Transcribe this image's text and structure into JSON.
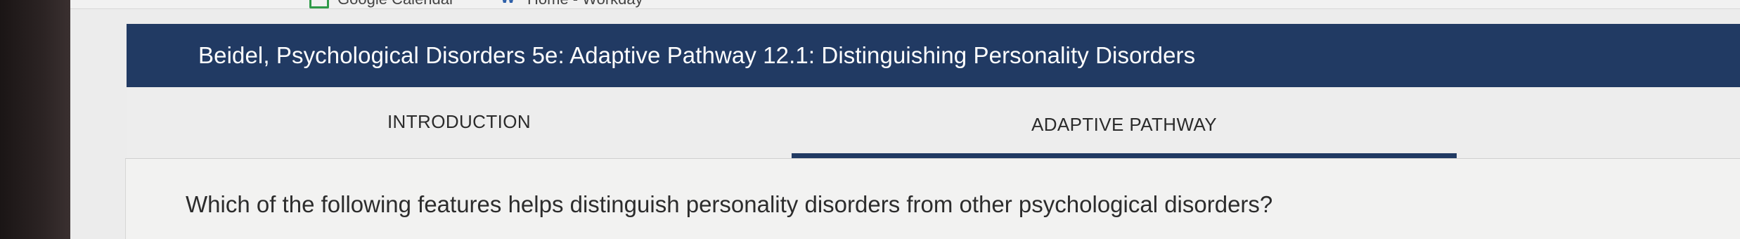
{
  "bookmarks": {
    "items": [
      {
        "label": "Google Calendar",
        "icon": "calendar-icon"
      },
      {
        "label": "Home - Workday",
        "icon": "workday-icon"
      }
    ]
  },
  "header": {
    "title": "Beidel, Psychological Disorders 5e: Adaptive Pathway 12.1: Distinguishing Personality Disorders"
  },
  "tabs": [
    {
      "label": "INTRODUCTION",
      "active": false
    },
    {
      "label": "ADAPTIVE PATHWAY",
      "active": true
    }
  ],
  "main": {
    "question": "Which of the following features helps distinguish personality disorders from other psychological disorders?"
  },
  "colors": {
    "banner": "#213a63",
    "tab_underline": "#213a63",
    "tab_background": "#ededed",
    "content_background": "#f2f2f1"
  }
}
